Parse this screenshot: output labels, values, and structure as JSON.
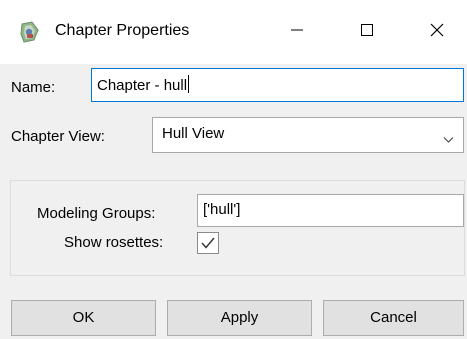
{
  "window": {
    "title": "Chapter Properties",
    "icons": {
      "app": "chapter-icon",
      "minimize": "minimize-icon",
      "maximize": "maximize-icon",
      "close": "close-icon"
    }
  },
  "form": {
    "name_label": "Name:",
    "name_value": "Chapter - hull",
    "chapter_view_label": "Chapter View:",
    "chapter_view_value": "Hull View",
    "modeling_groups_label": "Modeling Groups:",
    "modeling_groups_value": "['hull']",
    "show_rosettes_label": "Show rosettes:",
    "show_rosettes_checked": true
  },
  "buttons": {
    "ok": "OK",
    "apply": "Apply",
    "cancel": "Cancel"
  },
  "colors": {
    "focus_border": "#0078d7",
    "button_face": "#e1e1e1",
    "dialog_bg": "#f0f0f0"
  }
}
